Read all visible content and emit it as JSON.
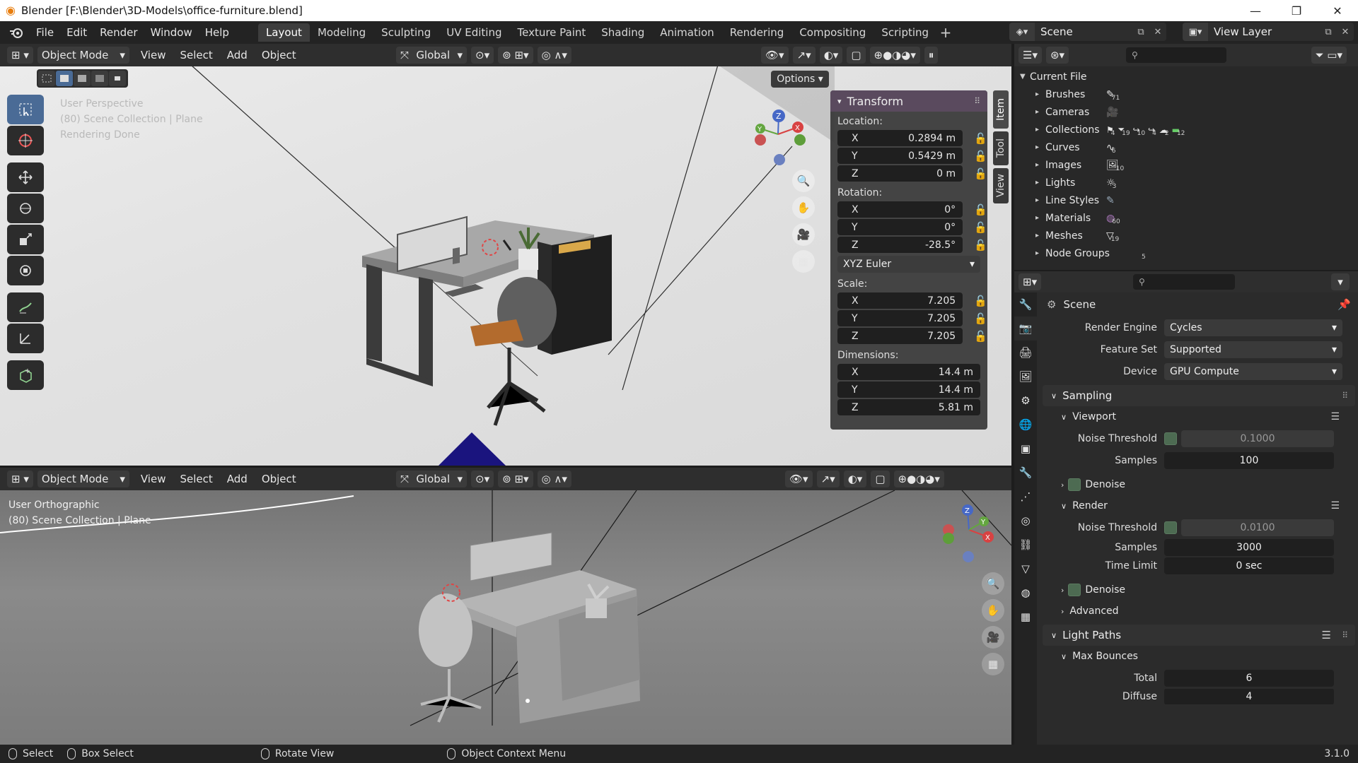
{
  "window": {
    "title": "Blender [F:\\Blender\\3D-Models\\office-furniture.blend]"
  },
  "menu": [
    "File",
    "Edit",
    "Render",
    "Window",
    "Help"
  ],
  "workspaces": [
    "Layout",
    "Modeling",
    "Sculpting",
    "UV Editing",
    "Texture Paint",
    "Shading",
    "Animation",
    "Rendering",
    "Compositing",
    "Scripting"
  ],
  "scene_name": "Scene",
  "view_layer_name": "View Layer",
  "viewport_top": {
    "mode": "Object Mode",
    "menus": [
      "View",
      "Select",
      "Add",
      "Object"
    ],
    "orientation": "Global",
    "options_label": "Options",
    "overlay_lines": [
      "User Perspective",
      "(80) Scene Collection | Plane",
      "Rendering Done"
    ]
  },
  "viewport_bottom": {
    "mode": "Object Mode",
    "menus": [
      "View",
      "Select",
      "Add",
      "Object"
    ],
    "orientation": "Global",
    "overlay_lines": [
      "User Orthographic",
      "(80) Scene Collection | Plane"
    ]
  },
  "npanel": {
    "title": "Transform",
    "location_label": "Location:",
    "location": [
      {
        "axis": "X",
        "value": "0.2894 m"
      },
      {
        "axis": "Y",
        "value": "0.5429 m"
      },
      {
        "axis": "Z",
        "value": "0 m"
      }
    ],
    "rotation_label": "Rotation:",
    "rotation": [
      {
        "axis": "X",
        "value": "0°"
      },
      {
        "axis": "Y",
        "value": "0°"
      },
      {
        "axis": "Z",
        "value": "-28.5°"
      }
    ],
    "rotation_mode": "XYZ Euler",
    "scale_label": "Scale:",
    "scale": [
      {
        "axis": "X",
        "value": "7.205"
      },
      {
        "axis": "Y",
        "value": "7.205"
      },
      {
        "axis": "Z",
        "value": "7.205"
      }
    ],
    "dimensions_label": "Dimensions:",
    "dimensions": [
      {
        "axis": "X",
        "value": "14.4 m"
      },
      {
        "axis": "Y",
        "value": "14.4 m"
      },
      {
        "axis": "Z",
        "value": "5.81 m"
      }
    ],
    "tabs": [
      "Item",
      "Tool",
      "View"
    ]
  },
  "outliner": {
    "root": "Current File",
    "items": [
      {
        "label": "Brushes",
        "count": "71"
      },
      {
        "label": "Cameras",
        "count": ""
      },
      {
        "label": "Collections",
        "count": ""
      },
      {
        "label": "Curves",
        "count": "6"
      },
      {
        "label": "Images",
        "count": "10"
      },
      {
        "label": "Lights",
        "count": "3"
      },
      {
        "label": "Line Styles",
        "count": ""
      },
      {
        "label": "Materials",
        "count": "60"
      },
      {
        "label": "Meshes",
        "count": "19"
      },
      {
        "label": "Node Groups",
        "count": "5"
      }
    ],
    "collection_counts": [
      "4",
      "19",
      "10",
      "4",
      "2",
      "12"
    ]
  },
  "properties": {
    "context": "Scene",
    "render_engine_label": "Render Engine",
    "render_engine": "Cycles",
    "feature_set_label": "Feature Set",
    "feature_set": "Supported",
    "device_label": "Device",
    "device": "GPU Compute",
    "sampling": "Sampling",
    "viewport": "Viewport",
    "viewport_noise_label": "Noise Threshold",
    "viewport_noise": "0.1000",
    "viewport_samples_label": "Samples",
    "viewport_samples": "100",
    "denoise": "Denoise",
    "render": "Render",
    "render_noise_label": "Noise Threshold",
    "render_noise": "0.0100",
    "render_samples_label": "Samples",
    "render_samples": "3000",
    "time_limit_label": "Time Limit",
    "time_limit": "0 sec",
    "denoise2": "Denoise",
    "advanced": "Advanced",
    "light_paths": "Light Paths",
    "max_bounces": "Max Bounces",
    "total_label": "Total",
    "total": "6",
    "diffuse_label": "Diffuse",
    "diffuse": "4"
  },
  "status": {
    "select": "Select",
    "box_select": "Box Select",
    "rotate_view": "Rotate View",
    "context_menu": "Object Context Menu",
    "version": "3.1.0"
  }
}
